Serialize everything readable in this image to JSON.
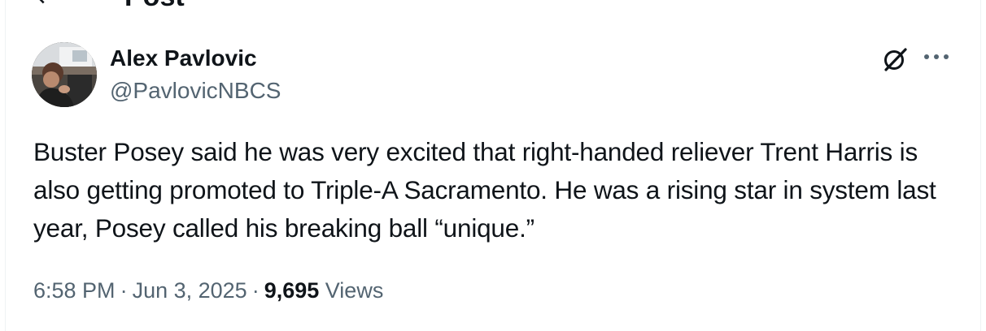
{
  "header": {
    "title": "Post"
  },
  "post": {
    "author": {
      "name": "Alex Pavlovic",
      "handle": "@PavlovicNBCS"
    },
    "text": "Buster Posey said he was very excited that right-handed reliever Trent Harris is also getting promoted to Triple-A Sacramento. He was a rising star in system last year, Posey called his breaking ball “unique.”",
    "time": "6:58 PM",
    "date": "Jun 3, 2025",
    "separator": "·",
    "views_count": "9,695",
    "views_label": "Views"
  },
  "icons": {
    "back": "arrow-left-icon",
    "grok": "grok-icon",
    "more": "more-horizontal-icon"
  },
  "colors": {
    "text_primary": "#0f1419",
    "text_secondary": "#536471",
    "border": "#eff3f4"
  }
}
